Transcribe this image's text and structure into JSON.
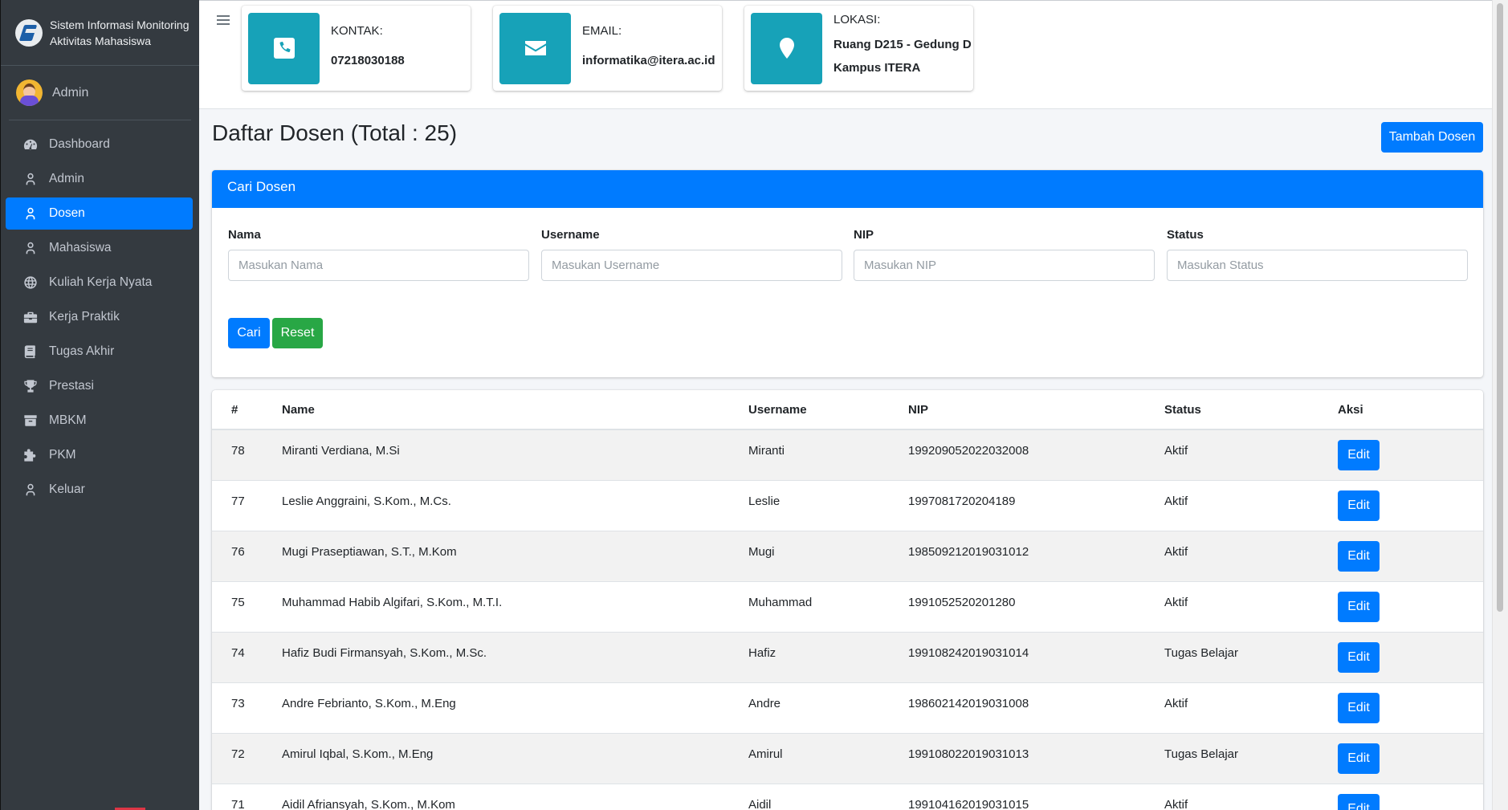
{
  "brand": {
    "line1": "Sistem Informasi Monitoring",
    "line2": "Aktivitas Mahasiswa"
  },
  "user": {
    "name": "Admin"
  },
  "sidebar": {
    "items": [
      {
        "label": "Dashboard",
        "icon": "dashboard-icon",
        "active": false
      },
      {
        "label": "Admin",
        "icon": "user-icon",
        "active": false
      },
      {
        "label": "Dosen",
        "icon": "user-icon",
        "active": true
      },
      {
        "label": "Mahasiswa",
        "icon": "user-icon",
        "active": false
      },
      {
        "label": "Kuliah Kerja Nyata",
        "icon": "globe-icon",
        "active": false
      },
      {
        "label": "Kerja Praktik",
        "icon": "briefcase-icon",
        "active": false
      },
      {
        "label": "Tugas Akhir",
        "icon": "book-icon",
        "active": false
      },
      {
        "label": "Prestasi",
        "icon": "trophy-icon",
        "active": false
      },
      {
        "label": "MBKM",
        "icon": "archive-icon",
        "active": false
      },
      {
        "label": "PKM",
        "icon": "puzzle-icon",
        "active": false
      },
      {
        "label": "Keluar",
        "icon": "user-icon",
        "active": false
      }
    ]
  },
  "info": {
    "contact": {
      "label": "KONTAK:",
      "value": "07218030188",
      "icon": "phone-icon"
    },
    "email": {
      "label": "EMAIL:",
      "value": "informatika@itera.ac.id",
      "icon": "envelope-icon"
    },
    "location": {
      "label": "LOKASI:",
      "value_line1": "Ruang D215 - Gedung D",
      "value_line2": "Kampus ITERA",
      "icon": "map-marker-icon"
    }
  },
  "page": {
    "title": "Daftar Dosen (Total : 25)",
    "add_button": "Tambah Dosen"
  },
  "search": {
    "title": "Cari Dosen",
    "fields": [
      {
        "label": "Nama",
        "placeholder": "Masukan Nama",
        "value": ""
      },
      {
        "label": "Username",
        "placeholder": "Masukan Username",
        "value": ""
      },
      {
        "label": "NIP",
        "placeholder": "Masukan NIP",
        "value": ""
      },
      {
        "label": "Status",
        "placeholder": "Masukan Status",
        "value": ""
      }
    ],
    "cari_label": "Cari",
    "reset_label": "Reset"
  },
  "table": {
    "headers": [
      "#",
      "Name",
      "Username",
      "NIP",
      "Status",
      "Aksi"
    ],
    "edit_label": "Edit",
    "rows": [
      {
        "id": "78",
        "name": "Miranti Verdiana, M.Si",
        "username": "Miranti",
        "nip": "199209052022032008",
        "status": "Aktif"
      },
      {
        "id": "77",
        "name": "Leslie Anggraini, S.Kom., M.Cs.",
        "username": "Leslie",
        "nip": "1997081720204189",
        "status": "Aktif"
      },
      {
        "id": "76",
        "name": "Mugi Praseptiawan, S.T., M.Kom",
        "username": "Mugi",
        "nip": "198509212019031012",
        "status": "Aktif"
      },
      {
        "id": "75",
        "name": "Muhammad Habib Algifari, S.Kom., M.T.I.",
        "username": "Muhammad",
        "nip": "1991052520201280",
        "status": "Aktif"
      },
      {
        "id": "74",
        "name": "Hafiz Budi Firmansyah, S.Kom., M.Sc.",
        "username": "Hafiz",
        "nip": "199108242019031014",
        "status": "Tugas Belajar"
      },
      {
        "id": "73",
        "name": "Andre Febrianto, S.Kom., M.Eng",
        "username": "Andre",
        "nip": "198602142019031008",
        "status": "Aktif"
      },
      {
        "id": "72",
        "name": "Amirul Iqbal, S.Kom., M.Eng",
        "username": "Amirul",
        "nip": "199108022019031013",
        "status": "Tugas Belajar"
      },
      {
        "id": "71",
        "name": "Aidil Afriansyah, S.Kom., M.Kom",
        "username": "Aidil",
        "nip": "199104162019031015",
        "status": "Aktif"
      }
    ]
  },
  "colors": {
    "primary": "#007bff",
    "success": "#28a745",
    "info": "#17a2b8",
    "sidebar": "#343a40"
  }
}
